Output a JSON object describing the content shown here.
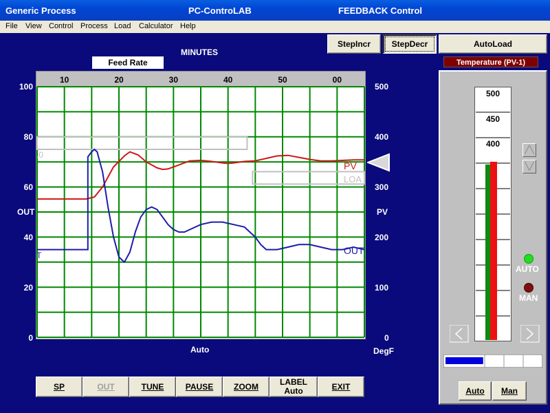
{
  "window": {
    "title_left": "Generic Process",
    "title_center": "PC-ControLAB",
    "title_right": "FEEDBACK Control"
  },
  "menu": [
    "File",
    "View",
    "Control",
    "Process",
    "Load",
    "Calculator",
    "Help"
  ],
  "top_buttons": {
    "step_incr": "StepIncr",
    "step_decr": "StepDecr",
    "auto_load": "AutoLoad"
  },
  "chart_header": {
    "minutes_label": "MINUTES",
    "feed_rate_label": "Feed Rate",
    "temperature_label": "Temperature   (PV-1)"
  },
  "chart_data": {
    "type": "line",
    "x_ticks": [
      "10",
      "20",
      "30",
      "40",
      "50",
      "00"
    ],
    "y_left_ticks": [
      "100",
      "80",
      "60",
      "40",
      "20",
      "0"
    ],
    "y_left_label": "OUT",
    "y_right_ticks": [
      "500",
      "400",
      "300",
      "200",
      "100",
      "0"
    ],
    "y_right_label": "PV",
    "y_right_unit": "DegF",
    "mode_label": "Auto",
    "x_range_minutes": [
      0,
      60
    ],
    "y_left_range": [
      0,
      100
    ],
    "y_right_range": [
      0,
      500
    ],
    "series": [
      {
        "name": "PV",
        "color": "#cc1818",
        "axis": "right",
        "points": [
          [
            0,
            276
          ],
          [
            9,
            276
          ],
          [
            10.5,
            280
          ],
          [
            12,
            300
          ],
          [
            14,
            340
          ],
          [
            16,
            362
          ],
          [
            17,
            370
          ],
          [
            18.5,
            364
          ],
          [
            20,
            350
          ],
          [
            22,
            338
          ],
          [
            23,
            335
          ],
          [
            24,
            336
          ],
          [
            26,
            344
          ],
          [
            28,
            352
          ],
          [
            30,
            353
          ],
          [
            32,
            351
          ],
          [
            34,
            348
          ],
          [
            35,
            347
          ],
          [
            36,
            348
          ],
          [
            38,
            351
          ],
          [
            40,
            352
          ],
          [
            42,
            357
          ],
          [
            44,
            362
          ],
          [
            46,
            363
          ],
          [
            48,
            359
          ],
          [
            50,
            355
          ],
          [
            52,
            352
          ],
          [
            54,
            352
          ],
          [
            56,
            353
          ],
          [
            58,
            354
          ],
          [
            60,
            354
          ]
        ]
      },
      {
        "name": "OUT",
        "color": "#1c1ca8",
        "axis": "left",
        "points": [
          [
            0,
            35
          ],
          [
            9.3,
            35
          ],
          [
            9.3,
            72
          ],
          [
            10,
            74
          ],
          [
            10.5,
            75
          ],
          [
            11,
            74
          ],
          [
            12,
            66
          ],
          [
            13,
            52
          ],
          [
            14,
            40
          ],
          [
            15,
            32
          ],
          [
            16,
            30
          ],
          [
            17,
            34
          ],
          [
            18,
            42
          ],
          [
            19,
            48
          ],
          [
            20,
            51
          ],
          [
            21,
            52
          ],
          [
            22,
            51
          ],
          [
            23,
            48
          ],
          [
            24,
            45
          ],
          [
            25,
            43
          ],
          [
            26,
            42
          ],
          [
            27,
            42
          ],
          [
            28,
            43
          ],
          [
            30,
            45
          ],
          [
            32,
            46
          ],
          [
            34,
            46
          ],
          [
            36,
            45
          ],
          [
            38,
            44
          ],
          [
            39,
            42
          ],
          [
            40,
            40
          ],
          [
            41,
            37
          ],
          [
            42,
            35
          ],
          [
            44,
            35
          ],
          [
            46,
            36
          ],
          [
            48,
            37
          ],
          [
            50,
            37
          ],
          [
            52,
            36
          ],
          [
            54,
            35
          ],
          [
            56,
            35
          ],
          [
            58,
            36
          ],
          [
            60,
            35
          ]
        ]
      }
    ],
    "setpoint_box": {
      "value_percent": 75,
      "label": ".0"
    },
    "load_box": {
      "value_percent": 65,
      "label": "LOA"
    },
    "series_labels": {
      "pv": "PV",
      "out": "OUT",
      "out_left_marker": "T"
    },
    "grid": true
  },
  "bar_gauge": {
    "ticks": [
      "500",
      "450",
      "400"
    ],
    "pv_fill_fraction": 0.7,
    "sp_fill_fraction": 0.7,
    "pv_color": "#ee1111",
    "sp_color": "#118811"
  },
  "status": {
    "auto_label": "AUTO",
    "man_label": "MAN",
    "auto_lamp_color": "#22dd22",
    "man_lamp_color": "#801010"
  },
  "out_bar_fraction": 0.38,
  "mode_buttons": {
    "auto": "Auto",
    "man": "Man"
  },
  "bottom_buttons": [
    {
      "label": "SP",
      "label2": "",
      "enabled": true
    },
    {
      "label": "OUT",
      "label2": "",
      "enabled": false
    },
    {
      "label": "TUNE",
      "label2": "",
      "enabled": true
    },
    {
      "label": "PAUSE",
      "label2": "",
      "enabled": true
    },
    {
      "label": "ZOOM",
      "label2": "",
      "enabled": true
    },
    {
      "label": "LABEL",
      "label2": "Auto",
      "enabled": true
    },
    {
      "label": "EXIT",
      "label2": "",
      "enabled": true
    }
  ]
}
